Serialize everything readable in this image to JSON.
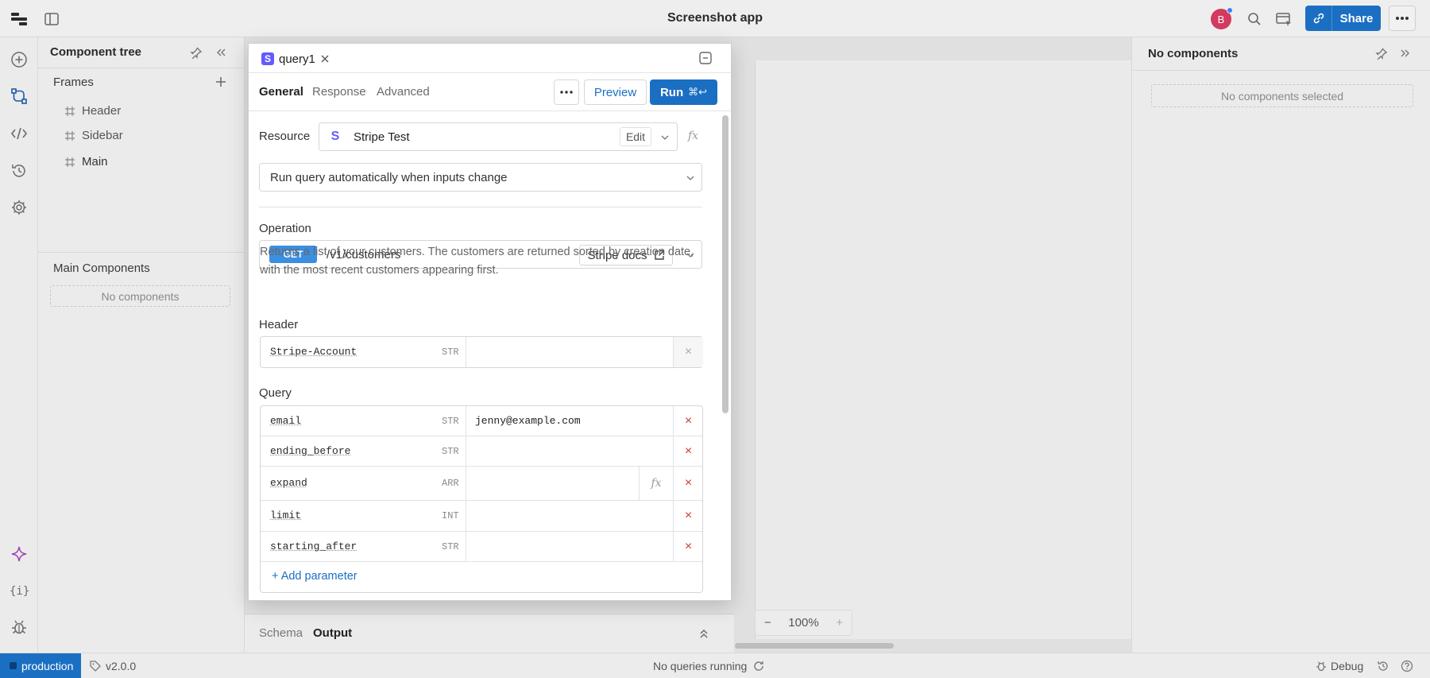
{
  "app": {
    "title": "Screenshot app",
    "avatar_initial": "B",
    "share_label": "Share"
  },
  "component_tree": {
    "title": "Component tree",
    "frames_label": "Frames",
    "frames": [
      "Header",
      "Sidebar",
      "Main"
    ],
    "main_components_label": "Main Components",
    "empty_label": "No components"
  },
  "inspector": {
    "title": "No components",
    "empty_label": "No components selected"
  },
  "canvas": {
    "zoom": "100%"
  },
  "bottom_panel": {
    "tabs": [
      "Schema",
      "Output"
    ]
  },
  "status": {
    "environment": "production",
    "version": "v2.0.0",
    "queries": "No queries running",
    "debug_label": "Debug"
  },
  "query": {
    "tab_name": "query1",
    "tabs": [
      "General",
      "Response",
      "Advanced"
    ],
    "preview_label": "Preview",
    "run_label": "Run",
    "run_shortcut": "⌘↩",
    "resource_label": "Resource",
    "resource_value": "Stripe Test",
    "resource_edit": "Edit",
    "trigger_value": "Run query automatically when inputs change",
    "operation_label": "Operation",
    "operation_method": "GET",
    "operation_path": "/v1/customers",
    "docs_label": "Stripe docs",
    "description": "Returns a list of your customers. The customers are returned sorted by creation date, with the most recent customers appearing first.",
    "header_label": "Header",
    "header_params": [
      {
        "key": "Stripe-Account",
        "type": "STR",
        "value": ""
      }
    ],
    "query_label": "Query",
    "query_params": [
      {
        "key": "email",
        "type": "STR",
        "value": "jenny@example.com"
      },
      {
        "key": "ending_before",
        "type": "STR",
        "value": ""
      },
      {
        "key": "expand",
        "type": "ARR",
        "value": ""
      },
      {
        "key": "limit",
        "type": "INT",
        "value": ""
      },
      {
        "key": "starting_after",
        "type": "STR",
        "value": ""
      }
    ],
    "add_parameter_label": "+ Add parameter"
  },
  "colors": {
    "accent": "#1b6fc2",
    "stripe": "#635bff",
    "get_badge": "#3b8fe0",
    "remove": "#d23a3a"
  }
}
